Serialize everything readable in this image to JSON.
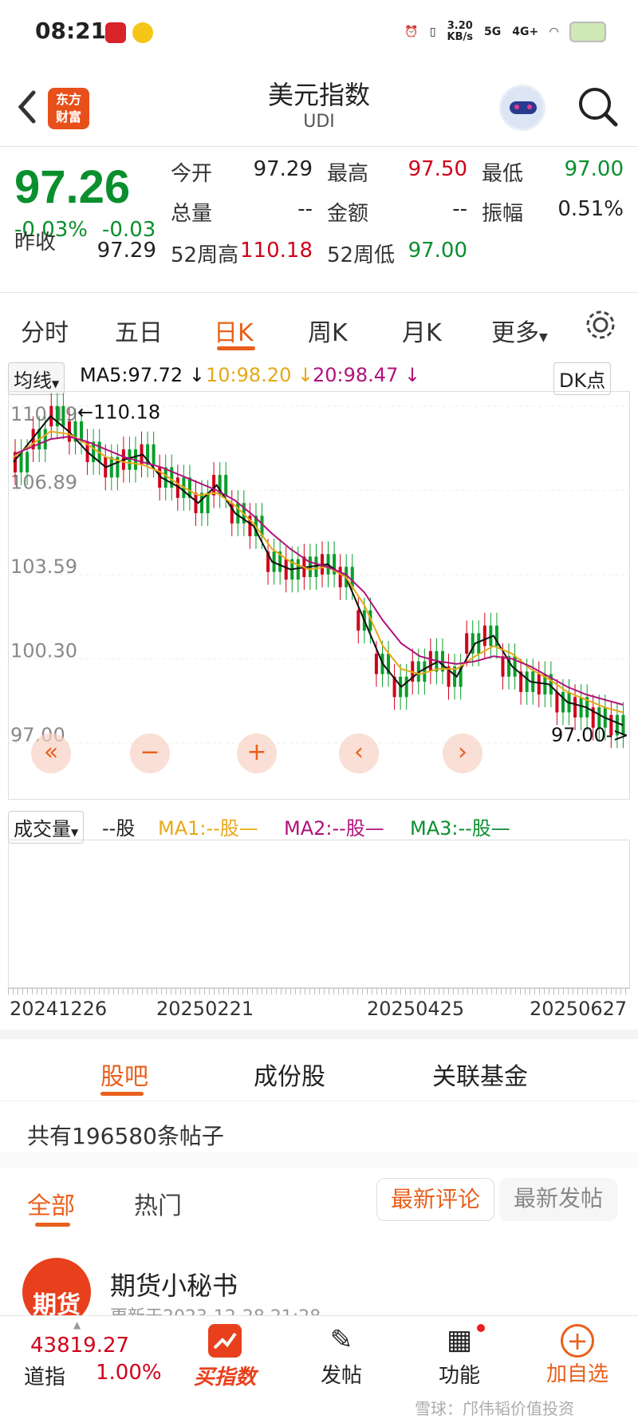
{
  "status_bar": {
    "time": "08:21",
    "net_speed": "3.20\nKB/s",
    "net_speed_value": "3.20",
    "net_speed_unit": "KB/s",
    "signal1": "5G",
    "signal2": "4G+"
  },
  "header": {
    "logo_text": "东方\n财富",
    "logo_l1": "东方",
    "logo_l2": "财富",
    "title": "美元指数",
    "subtitle": "UDI"
  },
  "quote": {
    "price": "97.26",
    "change_pct": "-0.03%",
    "change": "-0.03",
    "open_label": "今开",
    "open": "97.29",
    "high_label": "最高",
    "high": "97.50",
    "low_label": "最低",
    "low": "97.00",
    "volume_label": "总量",
    "volume": "--",
    "amount_label": "金额",
    "amount": "--",
    "amplitude_label": "振幅",
    "amplitude": "0.51%",
    "prev_close_label": "昨收",
    "prev_close": "97.29",
    "wk52_high_label": "52周高",
    "wk52_high": "110.18",
    "wk52_low_label": "52周低",
    "wk52_low": "97.00"
  },
  "tabs": [
    "分时",
    "五日",
    "日K",
    "周K",
    "月K",
    "更多"
  ],
  "active_tab": "日K",
  "chart": {
    "indicator_select": "均线",
    "ma5": "MA5:97.72 ↓",
    "ma10": "10:98.20 ↓",
    "ma20": "20:98.47 ↓",
    "dk_button": "DK点",
    "y_ticks": [
      "110.19",
      "106.89",
      "103.59",
      "100.30",
      "97.00"
    ],
    "max_marker": "←110.18",
    "min_marker": "97.00->",
    "colors": {
      "ma5": "#111111",
      "ma10": "#e6a817",
      "ma20": "#b0127a",
      "up": "#d0021b",
      "down": "#0a9e2b"
    }
  },
  "chart_data": {
    "type": "line",
    "title": "",
    "x_ticks": [
      "20241226",
      "20250221",
      "20250425",
      "20250627"
    ],
    "ylim": [
      97.0,
      110.19
    ],
    "series": [
      {
        "name": "MA5",
        "values": [
          108.0,
          108.9,
          109.8,
          109.2,
          108.4,
          107.8,
          108.1,
          108.3,
          107.4,
          107.0,
          106.4,
          107.1,
          106.0,
          105.5,
          104.1,
          103.8,
          103.9,
          104.0,
          103.5,
          101.8,
          100.1,
          99.2,
          99.8,
          100.2,
          99.6,
          100.9,
          101.2,
          100.0,
          99.4,
          99.3,
          98.6,
          98.4,
          98.0,
          97.7
        ]
      },
      {
        "name": "MA10",
        "values": [
          108.2,
          108.7,
          109.2,
          109.1,
          108.7,
          108.2,
          108.0,
          107.9,
          107.6,
          107.1,
          106.7,
          106.8,
          106.3,
          105.6,
          104.6,
          104.1,
          103.8,
          103.9,
          103.5,
          102.4,
          100.8,
          99.9,
          99.7,
          99.9,
          99.9,
          100.4,
          100.8,
          100.5,
          99.9,
          99.5,
          99.0,
          98.7,
          98.4,
          98.2
        ]
      },
      {
        "name": "MA20",
        "values": [
          108.3,
          108.6,
          108.9,
          109.0,
          108.8,
          108.5,
          108.2,
          108.0,
          107.8,
          107.5,
          107.2,
          106.9,
          106.5,
          105.9,
          105.2,
          104.6,
          104.1,
          103.9,
          103.6,
          102.9,
          101.8,
          100.9,
          100.4,
          100.2,
          100.1,
          100.2,
          100.4,
          100.3,
          100.0,
          99.6,
          99.2,
          98.9,
          98.7,
          98.5
        ]
      }
    ]
  },
  "volume": {
    "select": "成交量",
    "unit": "--股",
    "ma1": "MA1:--股—",
    "ma2": "MA2:--股—",
    "ma3": "MA3:--股—"
  },
  "section_tabs": [
    "股吧",
    "成份股",
    "关联基金"
  ],
  "posts": {
    "count_text": "共有196580条帖子",
    "filter_all": "全部",
    "filter_hot": "热门",
    "sort_latest_comment": "最新评论",
    "sort_latest_post": "最新发帖"
  },
  "post_item": {
    "avatar_text": "期货",
    "author": "期货小秘书",
    "time": "更新于2023-12-28 21:28"
  },
  "bottom_nav": {
    "index_value": "43819.27",
    "index_name": "道指",
    "index_change": "1.00%",
    "buy_index": "买指数",
    "post": "发帖",
    "functions": "功能",
    "add_watch": "加自选"
  },
  "watermark": "雪球：邝伟韬价值投资"
}
